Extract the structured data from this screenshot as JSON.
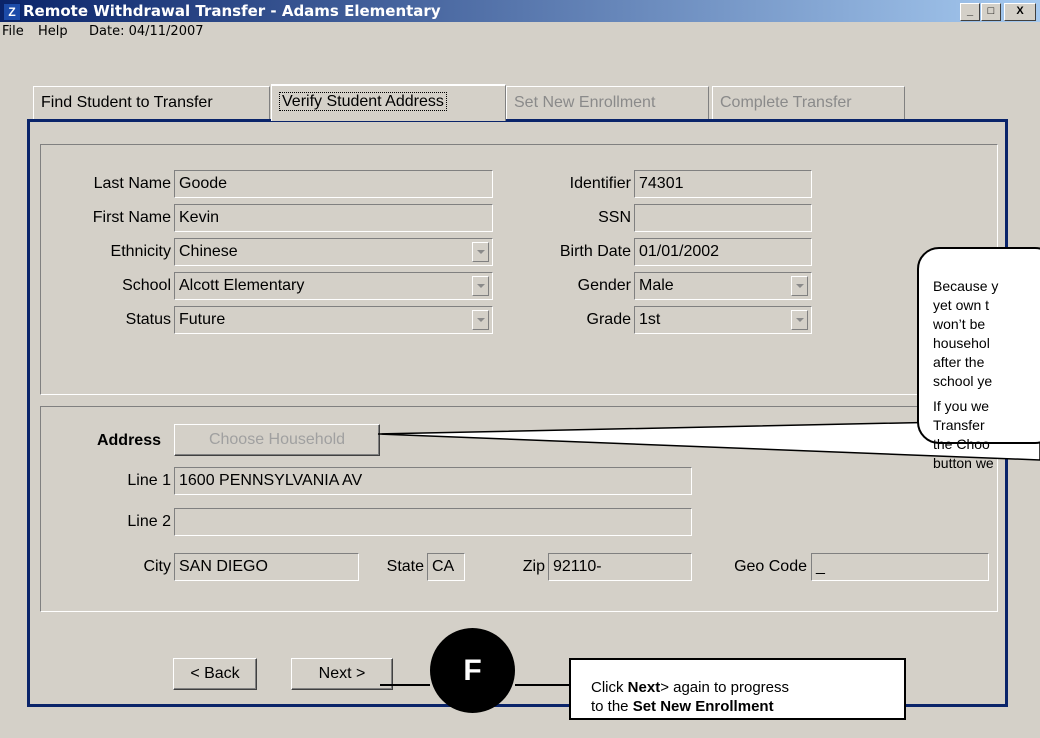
{
  "window": {
    "app_icon": "Z",
    "title": "Remote Withdrawal Transfer - Adams Elementary",
    "controls": {
      "minimize": "_",
      "maximize": "□",
      "close": "X"
    }
  },
  "menu": {
    "file": "File",
    "help": "Help",
    "date": "Date: 04/11/2007"
  },
  "tabs": [
    {
      "label": "Find Student to Transfer",
      "state": "normal"
    },
    {
      "label": "Verify Student Address",
      "state": "active"
    },
    {
      "label": "Set New Enrollment",
      "state": "disabled"
    },
    {
      "label": "Complete Transfer",
      "state": "disabled"
    }
  ],
  "student": {
    "last_name": {
      "label": "Last Name",
      "value": "Goode"
    },
    "first_name": {
      "label": "First Name",
      "value": "Kevin"
    },
    "ethnicity": {
      "label": "Ethnicity",
      "value": "Chinese"
    },
    "school": {
      "label": "School",
      "value": "Alcott Elementary"
    },
    "status": {
      "label": "Status",
      "value": "Future"
    },
    "identifier": {
      "label": "Identifier",
      "value": "74301"
    },
    "ssn": {
      "label": "SSN",
      "value": ""
    },
    "birth_date": {
      "label": "Birth Date",
      "value": "01/01/2002"
    },
    "gender": {
      "label": "Gender",
      "value": "Male"
    },
    "grade": {
      "label": "Grade",
      "value": "1st"
    }
  },
  "address": {
    "heading": "Address",
    "choose_household": "Choose Household",
    "line1": {
      "label": "Line 1",
      "value": "1600 PENNSYLVANIA AV"
    },
    "line2": {
      "label": "Line 2",
      "value": ""
    },
    "city": {
      "label": "City",
      "value": "SAN DIEGO"
    },
    "state": {
      "label": "State",
      "value": "CA"
    },
    "zip": {
      "label": "Zip",
      "value": "92110-"
    },
    "geo_code": {
      "label": "Geo Code",
      "value": "_"
    }
  },
  "nav": {
    "back": "< Back",
    "next": "Next >"
  },
  "callout_household": {
    "para1_lines": [
      "Because y",
      "yet own t",
      "won’t be",
      "househol",
      "after the",
      "school ye"
    ],
    "para2_lines": [
      "If you we",
      "Transfer ",
      "the Choo",
      "button we"
    ]
  },
  "step_marker": "F",
  "callout_next": {
    "line1_pre": "Click ",
    "line1_bold": "Next",
    "line1_post": "> again to progress",
    "line2_pre": "to the ",
    "line2_bold": "Set New Enrollment"
  },
  "colors": {
    "titlebar_start": "#0a246a",
    "titlebar_end": "#a6caf0",
    "panel_border": "#0a246a",
    "window_bg": "#d4d0c8"
  }
}
